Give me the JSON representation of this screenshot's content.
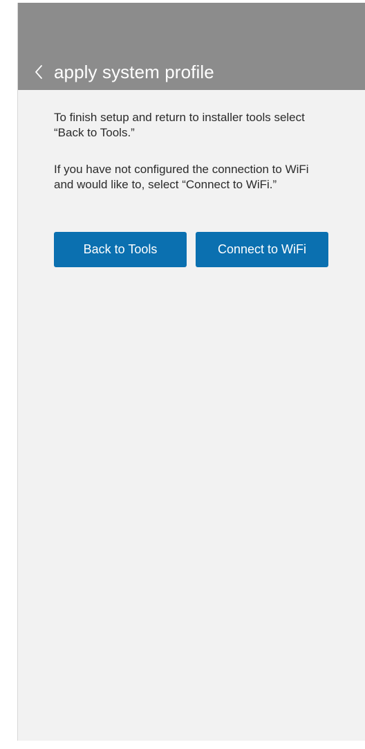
{
  "header": {
    "title": "apply system profile",
    "back_icon": "chevron-left-icon",
    "background": "#8c8c8c"
  },
  "main": {
    "paragraph_1": "To finish setup and return to installer tools select “Back to Tools.”",
    "paragraph_2": "If you have not configured the connection to WiFi and would like to, select “Connect to WiFi.”",
    "buttons": {
      "back_to_tools": "Back to Tools",
      "connect_to_wifi": "Connect to WiFi"
    },
    "button_color": "#0b70b0",
    "background": "#f2f2f2"
  }
}
